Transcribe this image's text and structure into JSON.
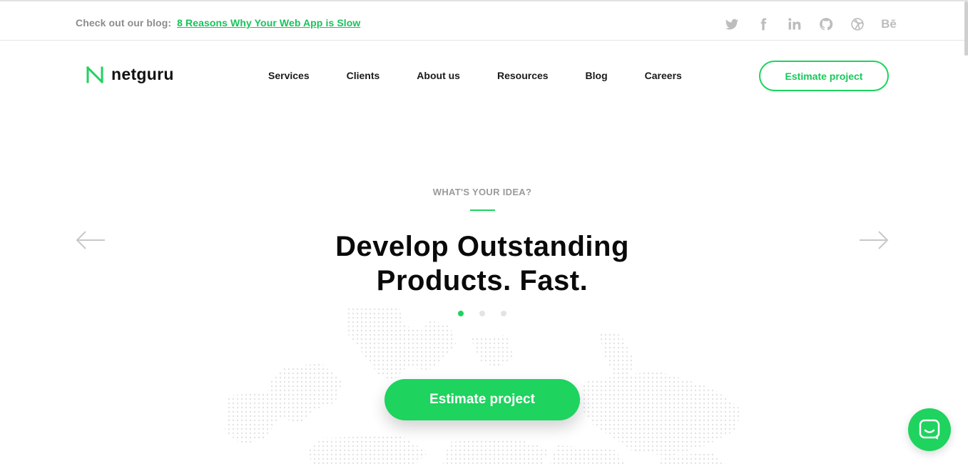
{
  "topbar": {
    "blog_prefix": "Check out our blog:",
    "blog_link": "8 Reasons Why Your Web App is Slow",
    "socials": [
      {
        "icon": "twitter-icon"
      },
      {
        "icon": "facebook-icon"
      },
      {
        "icon": "linkedin-icon"
      },
      {
        "icon": "github-icon"
      },
      {
        "icon": "dribbble-icon"
      },
      {
        "icon": "behance-icon",
        "glyph": "Bē"
      }
    ]
  },
  "header": {
    "logo_text": "netguru",
    "nav": [
      "Services",
      "Clients",
      "About us",
      "Resources",
      "Blog",
      "Careers"
    ],
    "cta_label": "Estimate project"
  },
  "hero": {
    "eyebrow": "WHAT'S YOUR IDEA?",
    "headline_line1": "Develop Outstanding",
    "headline_line2": "Products. Fast.",
    "slides": 3,
    "active_slide": 1,
    "cta_label": "Estimate project"
  },
  "colors": {
    "accent": "#1ed35e",
    "link": "#16c45a",
    "muted": "#8c8c8c"
  }
}
